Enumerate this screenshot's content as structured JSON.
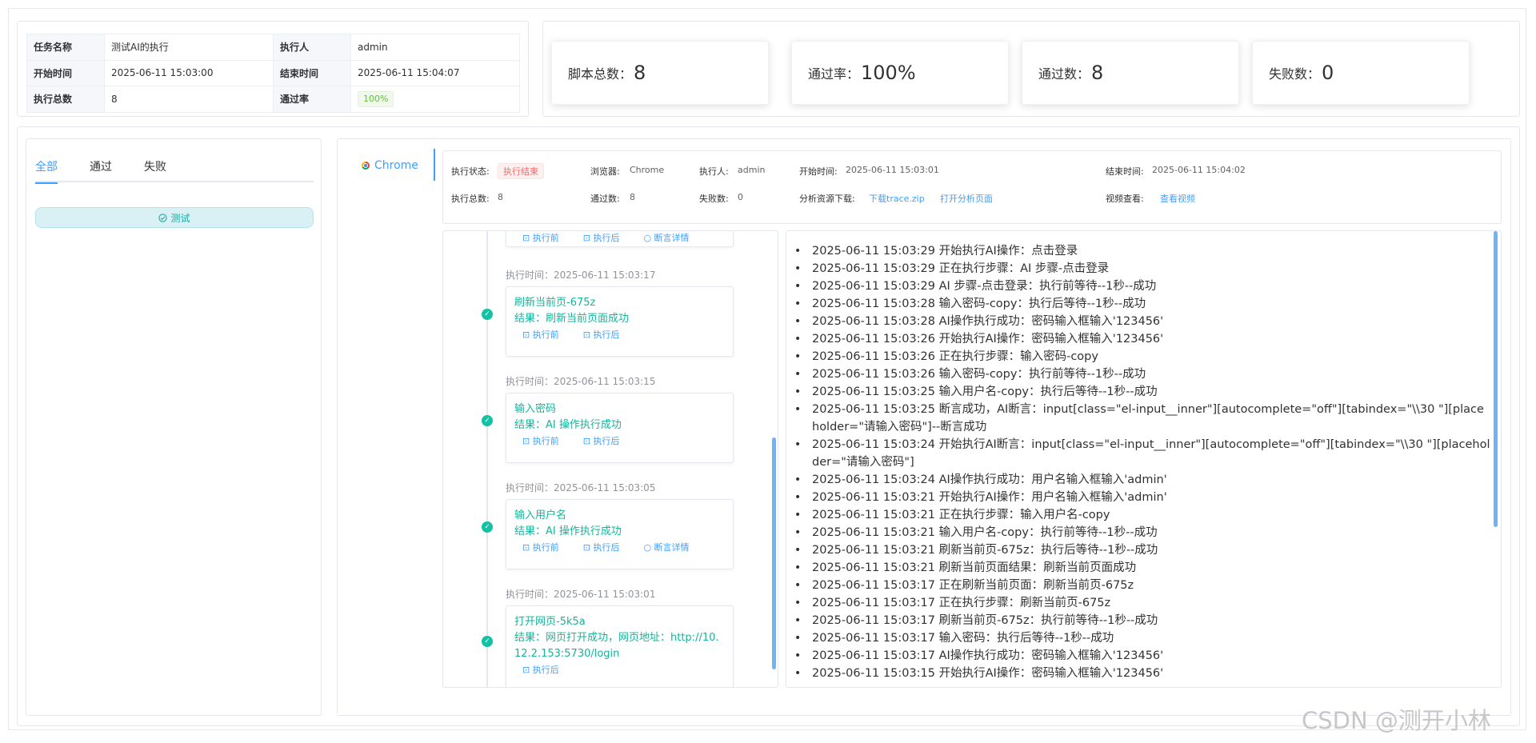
{
  "info": {
    "task_name_label": "任务名称",
    "task_name": "测试AI的执行",
    "executor_label": "执行人",
    "executor": "admin",
    "start_time_label": "开始时间",
    "start_time": "2025-06-11 15:03:00",
    "end_time_label": "结束时间",
    "end_time": "2025-06-11 15:04:07",
    "total_label": "执行总数",
    "total": "8",
    "pass_rate_label": "通过率",
    "pass_rate": "100%"
  },
  "stats": [
    {
      "label": "脚本总数：",
      "value": "8"
    },
    {
      "label": "通过率：",
      "value": "100%"
    },
    {
      "label": "通过数：",
      "value": "8"
    },
    {
      "label": "失败数：",
      "value": "0"
    }
  ],
  "filter": {
    "tabs": [
      "全部",
      "通过",
      "失败"
    ],
    "active_tab": "全部",
    "case_item": "测试"
  },
  "browser_tab": "Chrome",
  "meta": {
    "status_label": "执行状态:",
    "status": "执行结束",
    "browser_label": "浏览器:",
    "browser": "Chrome",
    "executor_label": "执行人:",
    "executor": "admin",
    "start_label": "开始时间:",
    "start": "2025-06-11 15:03:01",
    "end_label": "结束时间:",
    "end": "2025-06-11 15:04:02",
    "total_label": "执行总数:",
    "total": "8",
    "pass_label": "通过数:",
    "pass": "8",
    "fail_label": "失败数:",
    "fail": "0",
    "analysis_label": "分析资源下载:",
    "trace_link": "下载trace.zip",
    "open_analysis_link": "打开分析页面",
    "video_label": "视频查看:",
    "video_link": "查看视频"
  },
  "timeline": {
    "top_actions": [
      "执行前",
      "执行后",
      "断言详情"
    ],
    "steps": [
      {
        "time": "执行时间：2025-06-11 15:03:17",
        "title": "刷新当前页-675z",
        "result": "结果：刷新当前页面成功",
        "actions": [
          "执行前",
          "执行后"
        ]
      },
      {
        "time": "执行时间：2025-06-11 15:03:15",
        "title": "输入密码",
        "result": "结果：AI 操作执行成功",
        "actions": [
          "执行前",
          "执行后"
        ]
      },
      {
        "time": "执行时间：2025-06-11 15:03:05",
        "title": "输入用户名",
        "result": "结果：AI 操作执行成功",
        "actions": [
          "执行前",
          "执行后",
          "断言详情"
        ]
      },
      {
        "time": "执行时间：2025-06-11 15:03:01",
        "title": "打开网页-5k5a",
        "result": "结果：网页打开成功，网页地址：http://10.12.2.153:5730/login",
        "actions": [
          "执行后"
        ]
      }
    ]
  },
  "logs": [
    "2025-06-11 15:03:29 开始执行AI操作：点击登录",
    "2025-06-11 15:03:29 正在执行步骤：AI 步骤-点击登录",
    "2025-06-11 15:03:29 AI 步骤-点击登录：执行前等待--1秒--成功",
    "2025-06-11 15:03:28 输入密码-copy：执行后等待--1秒--成功",
    "2025-06-11 15:03:28 AI操作执行成功：密码输入框输入'123456'",
    "2025-06-11 15:03:26 开始执行AI操作：密码输入框输入'123456'",
    "2025-06-11 15:03:26 正在执行步骤：输入密码-copy",
    "2025-06-11 15:03:26 输入密码-copy：执行前等待--1秒--成功",
    "2025-06-11 15:03:25 输入用户名-copy：执行后等待--1秒--成功",
    "2025-06-11 15:03:25 断言成功，AI断言：input[class=\"el-input__inner\"][autocomplete=\"off\"][tabindex=\"\\\\30 \"][placeholder=\"请输入密码\"]--断言成功",
    "2025-06-11 15:03:24 开始执行AI断言：input[class=\"el-input__inner\"][autocomplete=\"off\"][tabindex=\"\\\\30 \"][placeholder=\"请输入密码\"]",
    "2025-06-11 15:03:24 AI操作执行成功：用户名输入框输入'admin'",
    "2025-06-11 15:03:21 开始执行AI操作：用户名输入框输入'admin'",
    "2025-06-11 15:03:21 正在执行步骤：输入用户名-copy",
    "2025-06-11 15:03:21 输入用户名-copy：执行前等待--1秒--成功",
    "2025-06-11 15:03:21 刷新当前页-675z：执行后等待--1秒--成功",
    "2025-06-11 15:03:21 刷新当前页面结果：刷新当前页面成功",
    "2025-06-11 15:03:17 正在刷新当前页面：刷新当前页-675z",
    "2025-06-11 15:03:17 正在执行步骤：刷新当前页-675z",
    "2025-06-11 15:03:17 刷新当前页-675z：执行前等待--1秒--成功",
    "2025-06-11 15:03:17 输入密码：执行后等待--1秒--成功",
    "2025-06-11 15:03:17 AI操作执行成功：密码输入框输入'123456'",
    "2025-06-11 15:03:15 开始执行AI操作：密码输入框输入'123456'"
  ],
  "watermark": "CSDN @测开小林"
}
